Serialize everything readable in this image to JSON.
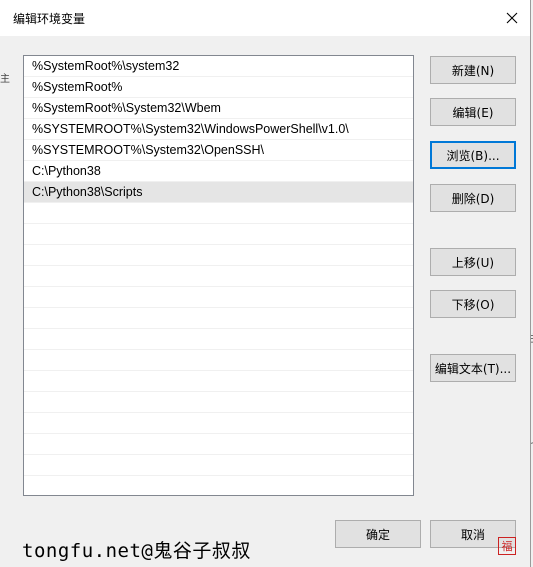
{
  "dialog": {
    "title": "编辑环境变量"
  },
  "path_list": {
    "items": [
      "%SystemRoot%\\system32",
      "%SystemRoot%",
      "%SystemRoot%\\System32\\Wbem",
      "%SYSTEMROOT%\\System32\\WindowsPowerShell\\v1.0\\",
      "%SYSTEMROOT%\\System32\\OpenSSH\\",
      "C:\\Python38",
      "C:\\Python38\\Scripts",
      "",
      "",
      "",
      "",
      "",
      "",
      "",
      "",
      "",
      "",
      "",
      "",
      "",
      ""
    ],
    "selected_index": 6
  },
  "buttons": {
    "new": "新建(N)",
    "edit": "编辑(E)",
    "browse": "浏览(B)...",
    "delete": "删除(D)",
    "move_up": "上移(U)",
    "move_down": "下移(O)",
    "edit_text": "编辑文本(T)...",
    "ok": "确定",
    "cancel": "取消"
  },
  "watermark": {
    "text": "tongfu.net@鬼谷子叔叔",
    "seal": "福"
  },
  "icons": {
    "close": "close-icon"
  },
  "colors": {
    "focus_border": "#0078d7",
    "selected_row": "#e5e5e5",
    "dialog_bg": "#f0f0f0"
  }
}
